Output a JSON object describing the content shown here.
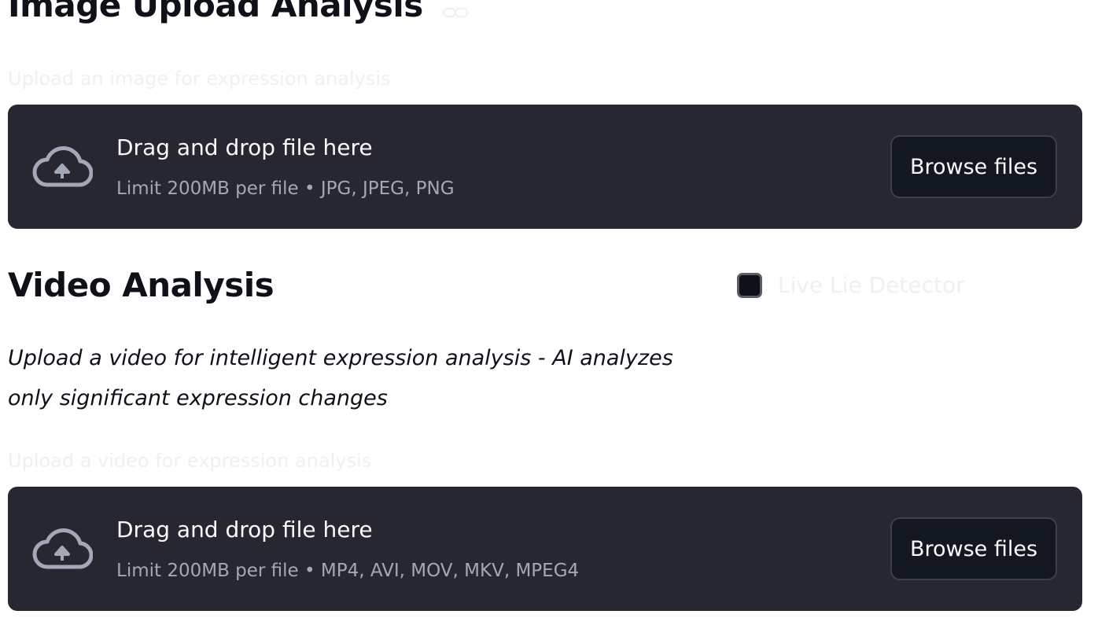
{
  "image_section": {
    "title": "Image Upload Analysis",
    "uploader_label": "Upload an image for expression analysis",
    "dropzone": {
      "title": "Drag and drop file here",
      "subtitle": "Limit 200MB per file • JPG, JPEG, PNG",
      "button_label": "Browse files",
      "icon": "cloud-upload-icon"
    },
    "anchor_icon": "link-icon"
  },
  "video_section": {
    "title": "Video Analysis",
    "toggle": {
      "label": "Live Lie Detector",
      "checked": false
    },
    "description": "Upload a video for intelligent expression analysis - AI analyzes only significant expression changes",
    "uploader_label": "Upload a video for expression analysis",
    "dropzone": {
      "title": "Drag and drop file here",
      "subtitle": "Limit 200MB per file • MP4, AVI, MOV, MKV, MPEG4",
      "button_label": "Browse files",
      "icon": "cloud-upload-icon"
    }
  },
  "colors": {
    "dropzone_bg": "#262730",
    "button_bg": "#131720",
    "text_primary": "#0e1117",
    "text_on_dark": "#fafafa",
    "text_muted": "#a3a8b8"
  }
}
